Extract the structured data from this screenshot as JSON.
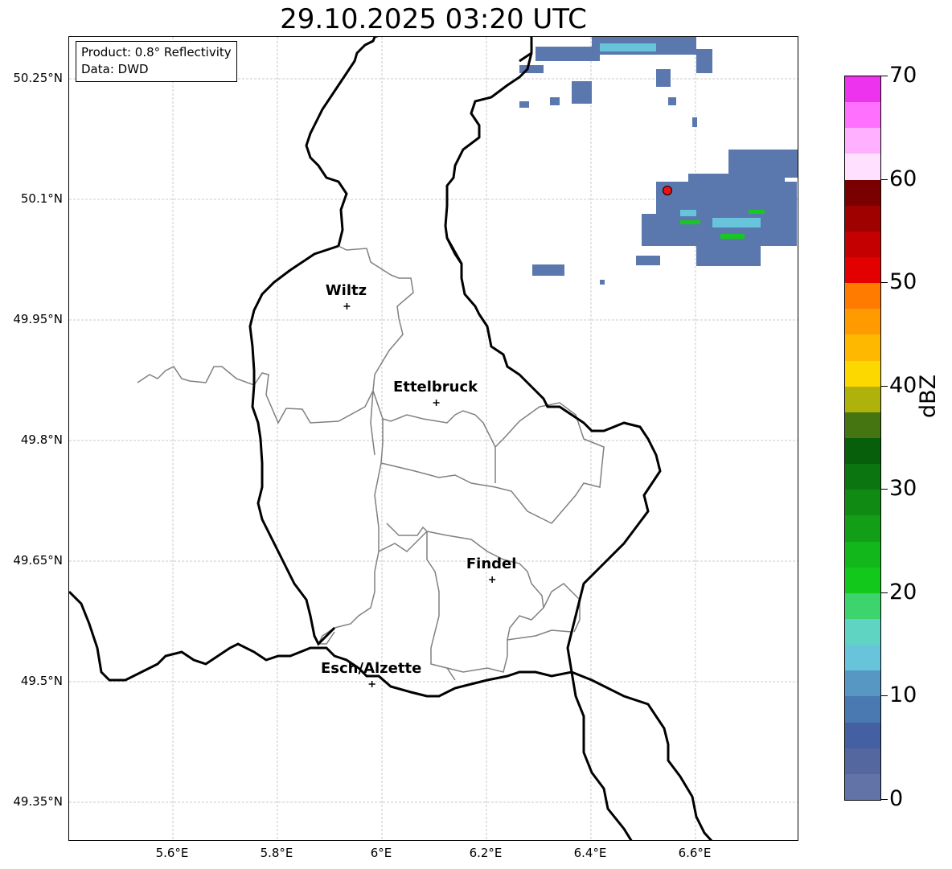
{
  "title": "29.10.2025 03:20 UTC",
  "info": {
    "product": "Product: 0.8° Reflectivity",
    "data": "Data: DWD"
  },
  "lat_labels": [
    "50.25°N",
    "50.1°N",
    "49.95°N",
    "49.8°N",
    "49.65°N",
    "49.5°N",
    "49.35°N"
  ],
  "lon_labels": [
    "5.6°E",
    "5.8°E",
    "6°E",
    "6.2°E",
    "6.4°E",
    "6.6°E"
  ],
  "cities": [
    {
      "name": "Wiltz",
      "lat": 49.967,
      "lon": 5.933
    },
    {
      "name": "Ettelbruck",
      "lat": 49.847,
      "lon": 6.104
    },
    {
      "name": "Findel",
      "lat": 49.627,
      "lon": 6.211
    },
    {
      "name": "Esch/Alzette",
      "lat": 49.497,
      "lon": 5.981
    }
  ],
  "radar_site": {
    "lat": 50.11,
    "lon": 6.548,
    "color": "#ee1111"
  },
  "colorbar": {
    "unit": "dBZ",
    "min": 0,
    "max": 70,
    "ticks": [
      "0",
      "10",
      "20",
      "30",
      "40",
      "50",
      "60",
      "70"
    ],
    "colors": [
      "#6273a8",
      "#54679f",
      "#4460a3",
      "#4a78b1",
      "#5797c4",
      "#67c4db",
      "#5fd4c2",
      "#3dd46d",
      "#12c81b",
      "#12b81b",
      "#129e16",
      "#108a12",
      "#0b7510",
      "#075f0c",
      "#457511",
      "#afb20a",
      "#fdd800",
      "#ffb800",
      "#ff9b00",
      "#ff7b00",
      "#e20000",
      "#c40000",
      "#9f0000",
      "#7a0000",
      "#ffe0ff",
      "#ffb0ff",
      "#ff70ff",
      "#ee33ee"
    ]
  }
}
